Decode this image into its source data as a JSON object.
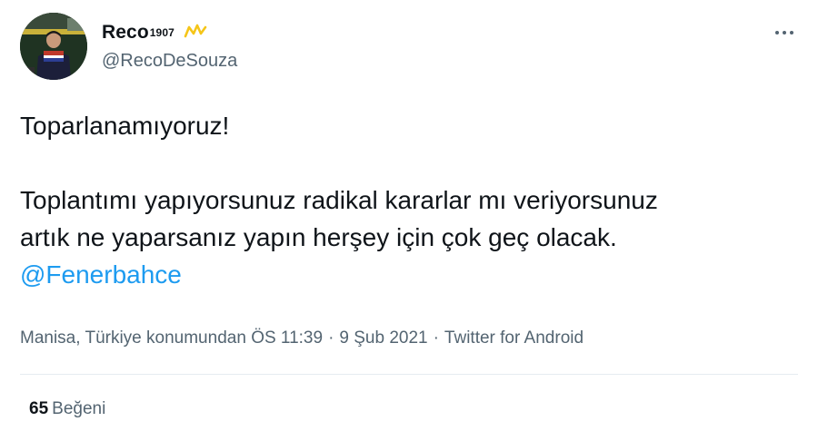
{
  "author": {
    "display_name": "Reco",
    "display_name_sup": "1907",
    "handle": "@RecoDeSouza",
    "crown_color": "#f5c518"
  },
  "tweet": {
    "line1": "Toparlanamıyoruz!",
    "line2": "Toplantımı yapıyorsunuz radikal kararlar mı veriyorsunuz",
    "line3": "artık ne yaparsanız yapın herşey için çok geç olacak.",
    "mention": "@Fenerbahce"
  },
  "meta": {
    "location": "Manisa, Türkiye konumundan",
    "time": "ÖS 11:39",
    "date": "9 Şub 2021",
    "source": "Twitter for Android",
    "separator": "·"
  },
  "stats": {
    "likes_count": "65",
    "likes_label": "Beğeni"
  },
  "colors": {
    "link": "#1d9bf0",
    "secondary_text": "#536471",
    "primary_text": "#0f1419"
  }
}
